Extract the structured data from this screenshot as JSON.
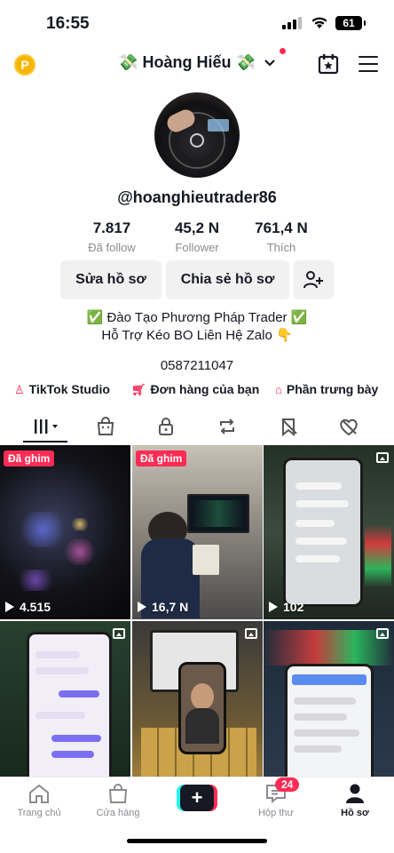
{
  "status_bar": {
    "time": "16:55",
    "battery": "61"
  },
  "header": {
    "display_name": "💸 Hoàng Hiếu 💸",
    "coin_label": "P"
  },
  "profile": {
    "username": "@hoanghieutrader86",
    "stats": [
      {
        "value": "7.817",
        "label": "Đã follow"
      },
      {
        "value": "45,2 N",
        "label": "Follower"
      },
      {
        "value": "761,4 N",
        "label": "Thích"
      }
    ],
    "buttons": {
      "edit": "Sửa hồ sơ",
      "share": "Chia sẻ hồ sơ"
    },
    "bio_line1": "✅ Đào Tạo Phương Pháp Trader ✅",
    "bio_line2": "Hỗ Trợ Kéo BO Liên Hệ Zalo 👇",
    "phone": "0587211047"
  },
  "quick_links": [
    {
      "label": "TikTok Studio",
      "icon": "studio-icon"
    },
    {
      "label": "Đơn hàng của bạn",
      "icon": "cart-icon"
    },
    {
      "label": "Phần trưng bày",
      "icon": "showcase-icon"
    }
  ],
  "tabs": [
    "videos-grid-icon",
    "shop-bag-icon",
    "lock-icon",
    "repost-icon",
    "saved-icon",
    "liked-icon"
  ],
  "videos": [
    {
      "pinned": "Đã ghim",
      "views": "4.515",
      "type": "video"
    },
    {
      "pinned": "Đã ghim",
      "views": "16,7 N",
      "type": "video"
    },
    {
      "pinned": "",
      "views": "102",
      "type": "photo"
    },
    {
      "pinned": "",
      "views": "",
      "type": "photo"
    },
    {
      "pinned": "",
      "views": "",
      "type": "photo"
    },
    {
      "pinned": "",
      "views": "",
      "type": "photo"
    }
  ],
  "bottom_nav": {
    "home": "Trang chủ",
    "shop": "Cửa hàng",
    "create": "+",
    "inbox": "Hộp thư",
    "inbox_badge": "24",
    "profile": "Hồ sơ"
  },
  "colors": {
    "accent": "#fe2c55",
    "text": "#161823",
    "muted": "#8a8b91",
    "button_bg": "#f1f1f2"
  }
}
